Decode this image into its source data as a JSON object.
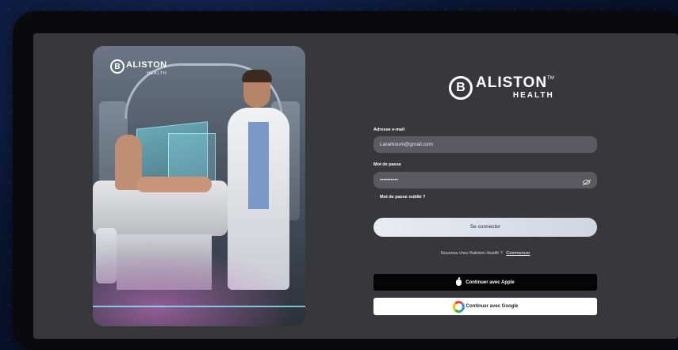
{
  "photo_logo": {
    "mark": "B",
    "wordmark": "ALISTON",
    "sub": "HEALTH"
  },
  "brand": {
    "mark": "B",
    "wordmark": "ALISTON",
    "tm": "TM",
    "sub": "HEALTH"
  },
  "form": {
    "email_label": "Adresse e-mail",
    "email_value": "Lararkouni@gmail.com",
    "password_label": "Mot de passe",
    "password_value": "••••••••••",
    "forgot_password": "Mot de passe oublié ?",
    "login_button": "Se connecter",
    "signup_prompt": "Nouveau chez Baliston Health ?",
    "signup_link": "Commencer",
    "apple_button": "Continuer avec Apple",
    "google_button": "Continuer avec Google"
  },
  "colors": {
    "screen_bg": "#38383c",
    "field_bg": "#5a5a60",
    "apple_button_bg": "#050506",
    "google_button_bg": "#ffffff"
  },
  "icons": [
    "eye-slash-icon",
    "apple-icon",
    "google-icon"
  ]
}
